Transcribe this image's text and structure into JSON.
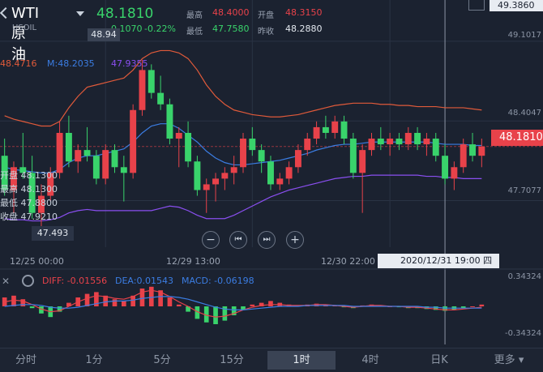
{
  "header": {
    "symbol": "WTI原油",
    "code": "USOIL",
    "price": "48.1810",
    "change": "-0.1070",
    "change_pct": "-0.22%",
    "high_label": "最高",
    "high": "48.4000",
    "open_label": "开盘",
    "open": "48.3150",
    "low_label": "最低",
    "low": "47.7580",
    "prev_close_label": "昨收",
    "prev_close": "48.2880"
  },
  "indicators": {
    "upper_val": "48.4716",
    "ma_label": "M:48.2035",
    "lower_val": "47.9355",
    "diff": "DIFF: -0.01556",
    "dea": "DEA:0.01543",
    "macd": "MACD: -0.06198"
  },
  "info_panel": {
    "lines": [
      "开盘 48.1300",
      "最高 48.1300",
      "最低 47.8800",
      "收盘 47.9210"
    ]
  },
  "colors": {
    "up": "#e8424a",
    "down": "#39d36b",
    "boll_upper": "#e05a3a",
    "ma": "#3b7de3",
    "boll_lower": "#8a4ff0",
    "diff": "#e8424a",
    "dea": "#3b7de3"
  },
  "chart_data": {
    "type": "candlestick",
    "y_ticks": [
      "49.1017",
      "48.4047",
      "47.7077"
    ],
    "top_value": "49.3860",
    "current_price_tag": "48.1810",
    "high_marker": "48.94",
    "low_marker": "47.493",
    "x_ticks": [
      "12/25 00:00",
      "12/29 13:00",
      "12/30 22:00"
    ],
    "crosshair_time": "2020/12/31 19:00 四",
    "macd_ticks": [
      "0.34324",
      "-0.34324"
    ],
    "ohlc": [
      [
        48.1,
        48.25,
        47.75,
        47.8
      ],
      [
        47.8,
        48.05,
        47.6,
        48.0
      ],
      [
        48.0,
        48.3,
        47.9,
        47.95
      ],
      [
        47.95,
        48.1,
        47.55,
        47.6
      ],
      [
        47.6,
        47.85,
        47.4,
        47.75
      ],
      [
        47.75,
        48.0,
        47.7,
        47.95
      ],
      [
        47.95,
        48.4,
        47.9,
        48.3
      ],
      [
        48.3,
        48.45,
        48.0,
        48.05
      ],
      [
        48.05,
        48.2,
        47.95,
        48.15
      ],
      [
        48.15,
        48.35,
        48.05,
        48.1
      ],
      [
        48.1,
        48.15,
        47.85,
        47.9
      ],
      [
        47.9,
        48.2,
        47.85,
        48.15
      ],
      [
        48.15,
        48.2,
        47.95,
        48.0
      ],
      [
        48.0,
        48.1,
        47.7,
        47.95
      ],
      [
        47.95,
        48.55,
        47.9,
        48.5
      ],
      [
        48.5,
        48.94,
        48.45,
        48.85
      ],
      [
        48.85,
        48.9,
        48.6,
        48.65
      ],
      [
        48.65,
        48.8,
        48.5,
        48.55
      ],
      [
        48.55,
        48.6,
        48.2,
        48.25
      ],
      [
        48.25,
        48.35,
        48.0,
        48.3
      ],
      [
        48.3,
        48.4,
        48.0,
        48.05
      ],
      [
        48.05,
        48.1,
        47.75,
        47.8
      ],
      [
        47.8,
        47.9,
        47.6,
        47.85
      ],
      [
        47.85,
        47.95,
        47.7,
        47.9
      ],
      [
        47.9,
        48.0,
        47.8,
        47.95
      ],
      [
        47.95,
        48.1,
        47.85,
        48.0
      ],
      [
        48.0,
        48.3,
        47.95,
        48.25
      ],
      [
        48.25,
        48.35,
        48.1,
        48.15
      ],
      [
        48.15,
        48.2,
        47.95,
        48.05
      ],
      [
        48.05,
        48.1,
        47.8,
        47.85
      ],
      [
        47.85,
        47.95,
        47.8,
        47.9
      ],
      [
        47.9,
        48.05,
        47.85,
        48.0
      ],
      [
        48.0,
        48.2,
        47.95,
        48.15
      ],
      [
        48.15,
        48.3,
        48.1,
        48.25
      ],
      [
        48.25,
        48.4,
        48.2,
        48.35
      ],
      [
        48.35,
        48.45,
        48.25,
        48.3
      ],
      [
        48.3,
        48.45,
        48.25,
        48.4
      ],
      [
        48.4,
        48.45,
        48.2,
        48.25
      ],
      [
        48.25,
        48.3,
        47.9,
        47.95
      ],
      [
        47.95,
        48.2,
        47.6,
        48.15
      ],
      [
        48.15,
        48.3,
        48.1,
        48.25
      ],
      [
        48.25,
        48.35,
        48.15,
        48.2
      ],
      [
        48.2,
        48.3,
        48.1,
        48.25
      ],
      [
        48.25,
        48.3,
        48.15,
        48.2
      ],
      [
        48.2,
        48.35,
        48.15,
        48.3
      ],
      [
        48.3,
        48.35,
        48.15,
        48.2
      ],
      [
        48.2,
        48.3,
        48.1,
        48.25
      ],
      [
        48.25,
        48.3,
        48.05,
        48.1
      ],
      [
        48.1,
        48.2,
        47.85,
        47.9
      ],
      [
        47.9,
        48.05,
        47.8,
        48.0
      ],
      [
        48.0,
        48.25,
        47.95,
        48.2
      ],
      [
        48.2,
        48.3,
        48.05,
        48.1
      ],
      [
        48.1,
        48.25,
        48.0,
        48.18
      ]
    ],
    "boll_upper": [
      48.45,
      48.42,
      48.4,
      48.38,
      48.36,
      48.36,
      48.4,
      48.52,
      48.62,
      48.7,
      48.72,
      48.74,
      48.76,
      48.78,
      48.85,
      48.95,
      49.0,
      49.02,
      49.02,
      49.0,
      48.95,
      48.85,
      48.72,
      48.62,
      48.55,
      48.5,
      48.48,
      48.46,
      48.45,
      48.44,
      48.44,
      48.45,
      48.46,
      48.48,
      48.5,
      48.52,
      48.54,
      48.55,
      48.56,
      48.56,
      48.56,
      48.55,
      48.55,
      48.54,
      48.54,
      48.53,
      48.53,
      48.53,
      48.52,
      48.52,
      48.52,
      48.51,
      48.5
    ],
    "boll_ma": [
      48.0,
      47.98,
      47.97,
      47.96,
      47.95,
      47.95,
      47.98,
      48.04,
      48.08,
      48.1,
      48.1,
      48.12,
      48.14,
      48.16,
      48.22,
      48.3,
      48.36,
      48.38,
      48.38,
      48.34,
      48.28,
      48.22,
      48.14,
      48.08,
      48.04,
      48.02,
      48.02,
      48.03,
      48.04,
      48.05,
      48.06,
      48.08,
      48.1,
      48.12,
      48.15,
      48.17,
      48.19,
      48.2,
      48.2,
      48.21,
      48.22,
      48.22,
      48.22,
      48.22,
      48.22,
      48.22,
      48.22,
      48.21,
      48.2,
      48.2,
      48.2,
      48.19,
      48.19
    ],
    "boll_lower": [
      47.55,
      47.54,
      47.54,
      47.53,
      47.53,
      47.54,
      47.56,
      47.6,
      47.62,
      47.63,
      47.62,
      47.62,
      47.62,
      47.62,
      47.62,
      47.62,
      47.62,
      47.64,
      47.66,
      47.65,
      47.62,
      47.58,
      47.55,
      47.55,
      47.55,
      47.58,
      47.62,
      47.66,
      47.7,
      47.74,
      47.77,
      47.8,
      47.82,
      47.84,
      47.86,
      47.88,
      47.9,
      47.91,
      47.92,
      47.92,
      47.93,
      47.93,
      47.93,
      47.93,
      47.93,
      47.93,
      47.92,
      47.92,
      47.91,
      47.91,
      47.9,
      47.9,
      47.9
    ],
    "macd_hist": [
      0.1,
      0.12,
      0.08,
      -0.02,
      -0.08,
      -0.12,
      -0.06,
      0.04,
      0.1,
      0.14,
      0.16,
      0.12,
      0.08,
      0.06,
      0.12,
      0.2,
      0.22,
      0.18,
      0.1,
      0.02,
      -0.06,
      -0.14,
      -0.18,
      -0.2,
      -0.16,
      -0.1,
      -0.04,
      0.02,
      0.04,
      0.06,
      0.04,
      0.02,
      0.01,
      0.02,
      0.03,
      0.02,
      0.01,
      -0.01,
      -0.02,
      0.01,
      0.02,
      0.01,
      0.0,
      -0.01,
      -0.02,
      -0.02,
      -0.03,
      -0.04,
      -0.05,
      -0.04,
      -0.02,
      0.0,
      0.02
    ],
    "diff": [
      0.05,
      0.07,
      0.06,
      0.02,
      -0.03,
      -0.06,
      -0.05,
      0.0,
      0.05,
      0.09,
      0.12,
      0.11,
      0.09,
      0.08,
      0.11,
      0.16,
      0.18,
      0.16,
      0.11,
      0.05,
      0.0,
      -0.06,
      -0.1,
      -0.12,
      -0.11,
      -0.08,
      -0.04,
      -0.01,
      0.01,
      0.02,
      0.02,
      0.01,
      0.01,
      0.01,
      0.02,
      0.02,
      0.01,
      0.0,
      -0.01,
      0.0,
      0.01,
      0.01,
      0.0,
      0.0,
      -0.01,
      -0.01,
      -0.02,
      -0.03,
      -0.04,
      -0.04,
      -0.03,
      -0.02,
      -0.01
    ],
    "dea": [
      0.0,
      0.01,
      0.02,
      0.02,
      0.01,
      -0.01,
      -0.02,
      -0.02,
      -0.01,
      0.01,
      0.03,
      0.05,
      0.06,
      0.06,
      0.07,
      0.09,
      0.1,
      0.11,
      0.11,
      0.1,
      0.08,
      0.05,
      0.02,
      -0.01,
      -0.03,
      -0.04,
      -0.04,
      -0.03,
      -0.02,
      -0.01,
      0.0,
      0.0,
      0.0,
      0.01,
      0.01,
      0.01,
      0.01,
      0.01,
      0.0,
      0.0,
      0.0,
      0.0,
      0.0,
      0.0,
      0.0,
      0.0,
      -0.01,
      -0.01,
      -0.02,
      -0.02,
      -0.02,
      -0.02,
      -0.02
    ]
  },
  "controls": {
    "zoom_out": "−",
    "first": "⏮",
    "last": "⏭",
    "zoom_in": "+"
  },
  "tabs": [
    "分时",
    "1分",
    "5分",
    "15分",
    "1时",
    "4时",
    "日K",
    "更多"
  ],
  "active_tab": "1时"
}
